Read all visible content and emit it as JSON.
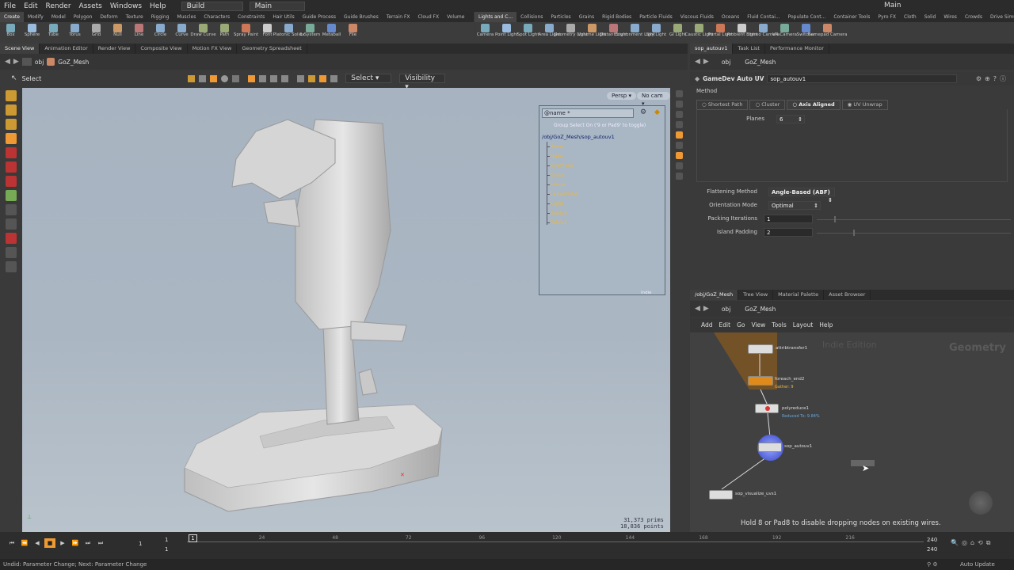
{
  "menubar": {
    "items": [
      "File",
      "Edit",
      "Render",
      "Assets",
      "Windows",
      "Help"
    ],
    "desktop": "Build",
    "main_label": "Main",
    "right_label": "Main"
  },
  "shelf_tabs_left": [
    "Create",
    "Modify",
    "Model",
    "Polygon",
    "Deform",
    "Texture",
    "Rigging",
    "Muscles",
    "Characters",
    "Constraints",
    "Hair Utils",
    "Guide Process",
    "Guide Brushes",
    "Terrain FX",
    "Cloud FX",
    "Volume"
  ],
  "shelf_tabs_right": [
    "Lights and C...",
    "Collisions",
    "Particles",
    "Grains",
    "Rigid Bodies",
    "Particle Fluids",
    "Viscous Fluids",
    "Oceans",
    "Fluid Contai...",
    "Populate Cont...",
    "Container Tools",
    "Pyro FX",
    "Cloth",
    "Solid",
    "Wires",
    "Crowds",
    "Drive Simula..."
  ],
  "tools_left": [
    "Box",
    "Sphere",
    "Tube",
    "Torus",
    "Grid",
    "Null",
    "Line",
    "Circle",
    "Curve",
    "Draw Curve",
    "Path",
    "Spray Paint",
    "Font",
    "Platonic Solids",
    "L-System",
    "Metaball",
    "File"
  ],
  "tools_right": [
    "Camera",
    "Point Light",
    "Spot Light",
    "Area Light",
    "Geometry Light",
    "Volume Light",
    "Distant Light",
    "Environment Light",
    "Sky Light",
    "GI Light",
    "Caustic Light",
    "Portal Light",
    "Ambient Light",
    "Stereo Camera",
    "VR Camera",
    "Switcher",
    "Gamepad Camera"
  ],
  "viewer_tabs": [
    "Scene View",
    "Animation Editor",
    "Render View",
    "Composite View",
    "Motion FX View",
    "Geometry Spreadsheet"
  ],
  "viewer_path": {
    "obj": "obj",
    "node": "GoZ_Mesh"
  },
  "viewer_toolbar": {
    "select": "Select",
    "select_mode": "Select",
    "visibility": "Visibility"
  },
  "viewport": {
    "persp": "Persp",
    "cam": "No cam",
    "prims": "31,373  prims",
    "points": "18,836  points"
  },
  "group_panel": {
    "name": "@name  *",
    "hint": "Group Select On ('9 or Pad9' to toggle)",
    "path": "/obj/GoZ_Mesh/sop_autouv1",
    "groups": [
      "Arms",
      "Base",
      "EyePiece",
      "Glass",
      "Hinge",
      "LenseTube",
      "Light",
      "Switch",
      "Table2"
    ],
    "footer": "Indie"
  },
  "param_tabs": [
    "sop_autouv1",
    "Task List",
    "Performance Monitor"
  ],
  "param_path": {
    "obj": "obj",
    "node": "GoZ_Mesh"
  },
  "params": {
    "node_type": "GameDev Auto UV",
    "node_name": "sop_autouv1",
    "method_label": "Method",
    "methods": [
      "Shortest Path",
      "Cluster",
      "Axis Aligned",
      "UV Unwrap"
    ],
    "planes_label": "Planes",
    "planes": "6",
    "flatten_label": "Flattening Method",
    "flatten": "Angle-Based (ABF)",
    "orient_label": "Orientation Mode",
    "orient": "Optimal",
    "pack_label": "Packing Iterations",
    "pack": "1",
    "island_label": "Island Padding",
    "island": "2"
  },
  "net_tabs": [
    "/obj/GoZ_Mesh",
    "Tree View",
    "Material Palette",
    "Asset Browser"
  ],
  "net_path": {
    "obj": "obj",
    "node": "GoZ_Mesh"
  },
  "net_menu": [
    "Add",
    "Edit",
    "Go",
    "View",
    "Tools",
    "Layout",
    "Help"
  ],
  "network": {
    "watermark": "Indie Edition",
    "context": "Geometry",
    "nodes": [
      {
        "name": "attribtransfer1",
        "sub": ""
      },
      {
        "name": "foreach_end2",
        "sub": "Gather: 9"
      },
      {
        "name": "polyreduce1",
        "sub": "Reduced To: 9.84%"
      },
      {
        "name": "sop_autouv1",
        "sub": ""
      },
      {
        "name": "sop_visualize_uvs1",
        "sub": ""
      }
    ],
    "hint": "Hold 8 or Pad8 to disable dropping nodes on existing wires."
  },
  "timeline": {
    "frame": "1",
    "start": "1",
    "start2": "1",
    "end": "240",
    "end2": "240",
    "ticks": [
      "24",
      "48",
      "72",
      "96",
      "120",
      "144",
      "168",
      "192",
      "216"
    ]
  },
  "status": {
    "text": "Undid: Parameter Change; Next: Parameter Change",
    "auto_update": "Auto Update"
  }
}
